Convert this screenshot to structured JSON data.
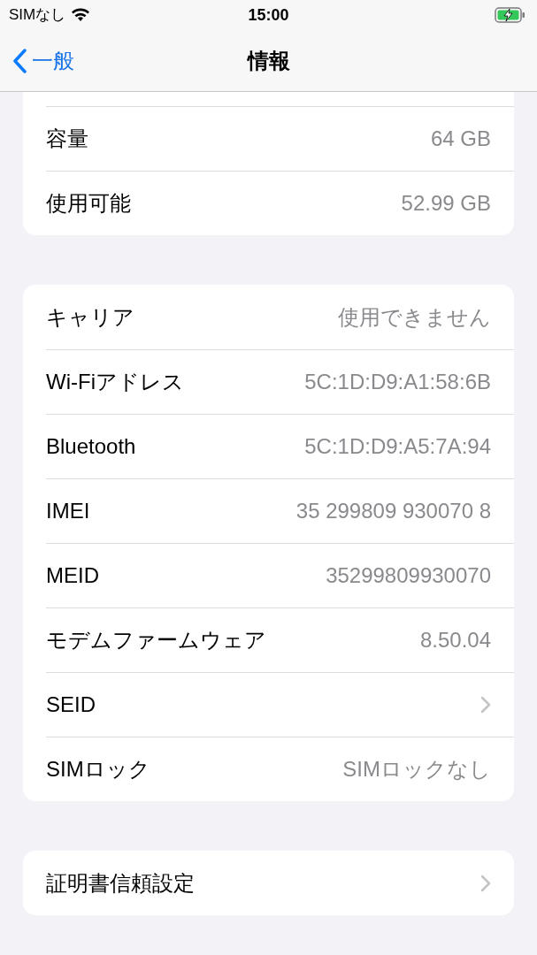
{
  "status_bar": {
    "carrier": "SIMなし",
    "time": "15:00"
  },
  "nav": {
    "back": "一般",
    "title": "情報"
  },
  "sections": [
    {
      "cut_top": true,
      "rows": [
        {
          "label": "容量",
          "value": "64 GB",
          "kind": "value"
        },
        {
          "label": "使用可能",
          "value": "52.99 GB",
          "kind": "value"
        }
      ]
    },
    {
      "cut_top": false,
      "rows": [
        {
          "label": "キャリア",
          "value": "使用できません",
          "kind": "value"
        },
        {
          "label": "Wi-Fiアドレス",
          "value": "5C:1D:D9:A1:58:6B",
          "kind": "value"
        },
        {
          "label": "Bluetooth",
          "value": "5C:1D:D9:A5:7A:94",
          "kind": "value"
        },
        {
          "label": "IMEI",
          "value": "35 299809 930070 8",
          "kind": "value"
        },
        {
          "label": "MEID",
          "value": "35299809930070",
          "kind": "value"
        },
        {
          "label": "モデムファームウェア",
          "value": "8.50.04",
          "kind": "value"
        },
        {
          "label": "SEID",
          "kind": "chevron"
        },
        {
          "label": "SIMロック",
          "value": "SIMロックなし",
          "kind": "value"
        }
      ]
    },
    {
      "cut_top": false,
      "rows": [
        {
          "label": "証明書信頼設定",
          "kind": "chevron"
        }
      ]
    }
  ]
}
